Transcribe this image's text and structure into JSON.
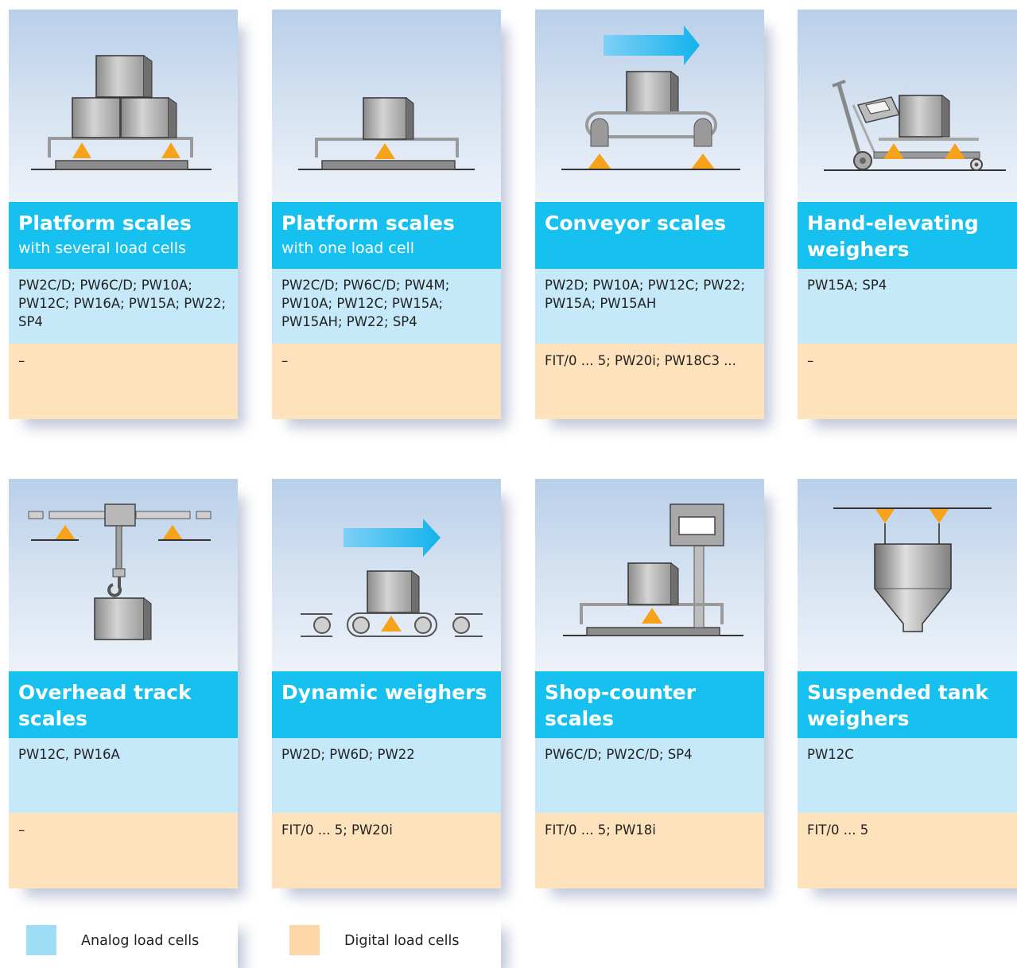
{
  "cards": [
    {
      "title": "Platform scales",
      "subtitle": "with several load cells",
      "analog": "PW2C/D; PW6C/D; PW10A; PW12C; PW16A; PW15A; PW22; SP4",
      "digital": "–"
    },
    {
      "title": "Platform scales",
      "subtitle": "with one load cell",
      "analog": "PW2C/D; PW6C/D; PW4M; PW10A; PW12C; PW15A; PW15AH; PW22; SP4",
      "digital": "–"
    },
    {
      "title": "Conveyor scales",
      "subtitle": "",
      "analog": "PW2D; PW10A; PW12C; PW22; PW15A; PW15AH",
      "digital": "FIT/0 ... 5; PW20i; PW18C3 ..."
    },
    {
      "title": "Hand-elevating weighers",
      "subtitle": "",
      "analog": "PW15A; SP4",
      "digital": "–"
    },
    {
      "title": "Overhead track scales",
      "subtitle": "",
      "analog": "PW12C, PW16A",
      "digital": "–"
    },
    {
      "title": "Dynamic weighers",
      "subtitle": "",
      "analog": "PW2D; PW6D; PW22",
      "digital": "FIT/0 ... 5; PW20i"
    },
    {
      "title": "Shop-counter scales",
      "subtitle": "",
      "analog": "PW6C/D; PW2C/D; SP4",
      "digital": "FIT/0 ... 5; PW18i"
    },
    {
      "title": "Suspended tank weighers",
      "subtitle": "",
      "analog": "PW12C",
      "digital": "FIT/0 ... 5"
    }
  ],
  "legend": {
    "analog_label": "Analog load cells",
    "digital_label": "Digital load cells",
    "analog_color": "#9fdcf6",
    "digital_color": "#fbd6a6"
  },
  "colors": {
    "title_band": "#16c1ef",
    "analog_band": "#c5e9f9",
    "digital_band": "#fde2bb",
    "load_cell": "#f7a21b"
  }
}
